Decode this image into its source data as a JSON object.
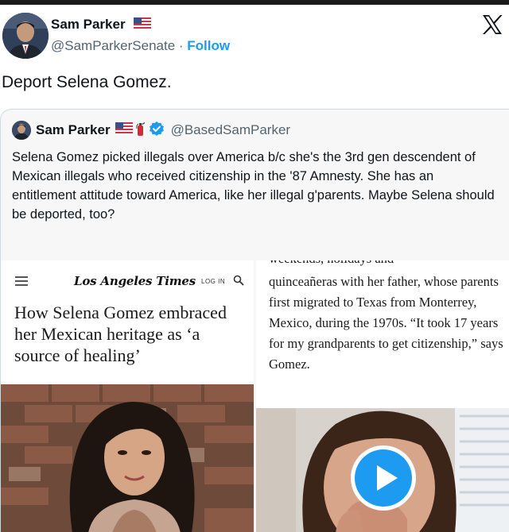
{
  "post": {
    "author_name": "Sam Parker",
    "author_handle": "@SamParkerSenate",
    "separator": " · ",
    "follow_label": "Follow",
    "text": "Deport Selena Gomez."
  },
  "quoted": {
    "author_name": "Sam Parker",
    "author_handle": "@BasedSamParker",
    "text": "Selena Gomez picked illegals over America b/c she's the 3rd gen descendent of Mexican illegals who received citizenship in the '87 Amnesty. She has an entitlement attitude toward America, like her illegal g'parents. Maybe Selena should be deported, too?"
  },
  "article": {
    "publication": "Los Angeles Times",
    "login_label": "LOG IN",
    "headline": "How Selena Gomez embraced her Mexican heritage as ‘a source of healing’",
    "cut_line": "weekends, holidays and",
    "body": "quinceañeras with her father, whose parents first migrated to Texas from Monterrey, Mexico, during the 1970s. “It took 17 years for my grandparents to get citizenship,” says Gomez."
  },
  "icons": {
    "x_logo": "x-logo-icon",
    "flag": "us-flag-icon",
    "extinguisher": "fire-extinguisher-icon",
    "verified": "verified-badge-icon",
    "menu": "hamburger-menu-icon",
    "search": "search-icon",
    "play": "play-icon"
  },
  "colors": {
    "link_blue": "#1d9bf0",
    "handle_gray": "#536471",
    "text": "#0f1419",
    "quote_bg": "#f7f7f7"
  }
}
